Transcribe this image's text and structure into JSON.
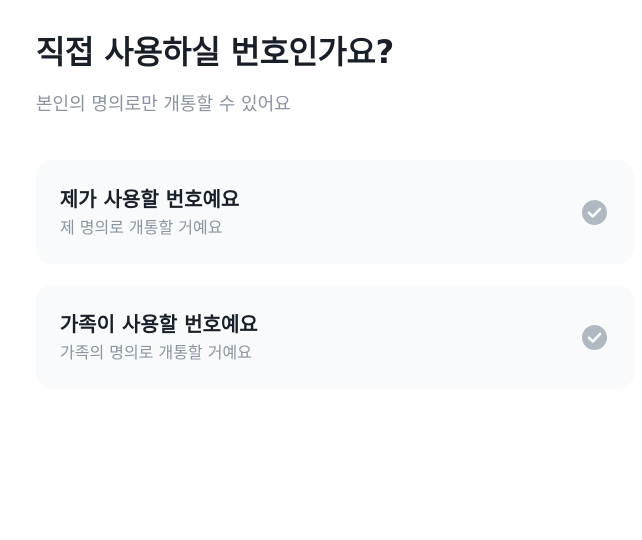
{
  "header": {
    "title": "직접 사용하실 번호인가요?",
    "subtitle": "본인의 명의로만 개통할 수 있어요"
  },
  "options": [
    {
      "title": "제가 사용할 번호예요",
      "description": "제 명의로 개통할 거예요",
      "icon": "check-circle-icon",
      "checked": false
    },
    {
      "title": "가족이 사용할 번호예요",
      "description": "가족의 명의로 개통할 거예요",
      "icon": "check-circle-icon",
      "checked": false
    }
  ],
  "colors": {
    "title": "#191f28",
    "subtitle": "#8b95a1",
    "card_background": "#f9fafb",
    "check_icon": "#b0b8c1"
  }
}
